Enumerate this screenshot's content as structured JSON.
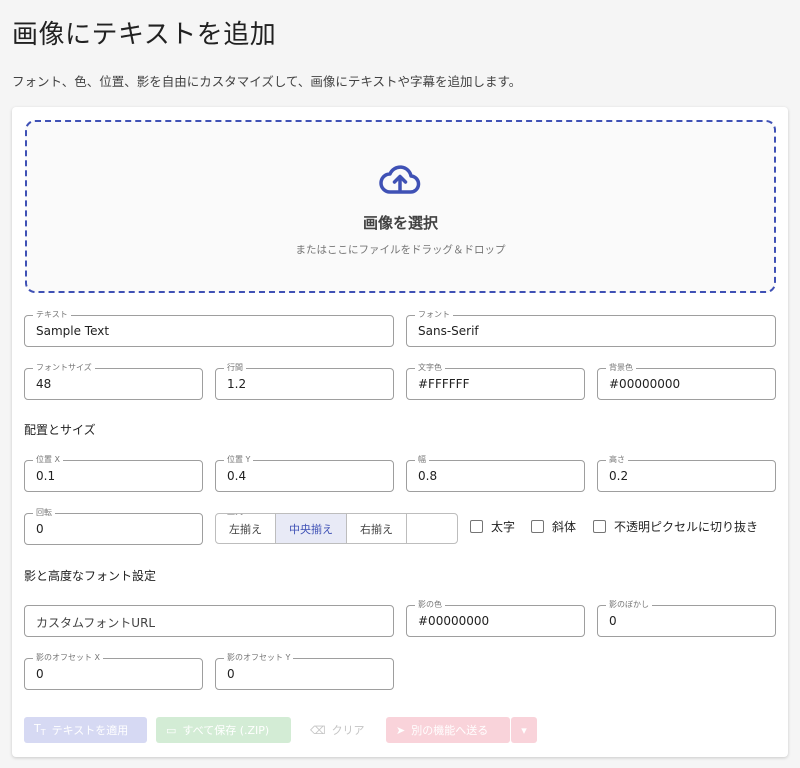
{
  "header": {
    "title": "画像にテキストを追加",
    "subtitle": "フォント、色、位置、影を自由にカスタマイズして、画像にテキストや字幕を追加します。"
  },
  "dropzone": {
    "title": "画像を選択",
    "subtitle": "またはここにファイルをドラッグ＆ドロップ",
    "icon": "cloud-upload-icon"
  },
  "fields": {
    "text": {
      "label": "テキスト",
      "value": "Sample Text"
    },
    "font": {
      "label": "フォント",
      "value": "Sans-Serif"
    },
    "font_size": {
      "label": "フォントサイズ",
      "value": "48"
    },
    "line_height": {
      "label": "行間",
      "value": "1.2"
    },
    "text_color": {
      "label": "文字色",
      "value": "#FFFFFF"
    },
    "bg_color": {
      "label": "背景色",
      "value": "#00000000"
    }
  },
  "layout_section": {
    "title": "配置とサイズ",
    "pos_x": {
      "label": "位置 X",
      "value": "0.1"
    },
    "pos_y": {
      "label": "位置 Y",
      "value": "0.4"
    },
    "width": {
      "label": "幅",
      "value": "0.8"
    },
    "height": {
      "label": "高さ",
      "value": "0.2"
    },
    "rotation": {
      "label": "回転",
      "value": "0"
    },
    "align": {
      "label": "整列",
      "options": [
        "左揃え",
        "中央揃え",
        "右揃え"
      ],
      "selected": "中央揃え"
    },
    "bold": {
      "label": "太字",
      "checked": false
    },
    "italic": {
      "label": "斜体",
      "checked": false
    },
    "crop": {
      "label": "不透明ピクセルに切り抜き",
      "checked": false
    }
  },
  "shadow_section": {
    "title": "影と高度なフォント設定",
    "custom_font": {
      "placeholder": "カスタムフォントURL"
    },
    "shadow_color": {
      "label": "影の色",
      "value": "#00000000"
    },
    "shadow_blur": {
      "label": "影のぼかし",
      "value": "0"
    },
    "offset_x": {
      "label": "影のオフセット X",
      "value": "0"
    },
    "offset_y": {
      "label": "影のオフセット Y",
      "value": "0"
    }
  },
  "actions": {
    "apply": "テキストを適用",
    "save": "すべて保存 (.ZIP)",
    "clear": "クリア",
    "send": "別の機能へ送る"
  },
  "colors": {
    "accent": "#3f51b5",
    "apply_bg": "#d6d9f3",
    "save_bg": "#d3ecd5",
    "send_bg": "#f9d3da"
  }
}
